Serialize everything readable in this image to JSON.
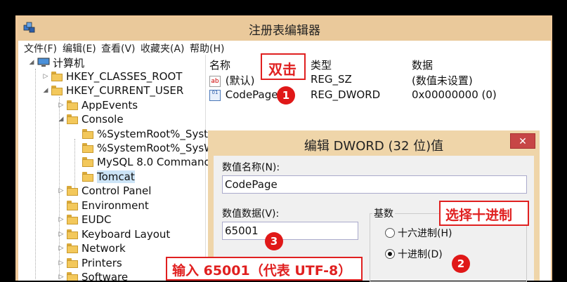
{
  "window": {
    "title": "注册表编辑器"
  },
  "menu": [
    "文件(F)",
    "编辑(E)",
    "查看(V)",
    "收藏夹(A)",
    "帮助(H)"
  ],
  "tree": [
    {
      "label": "计算机",
      "toggle": "◢"
    },
    {
      "label": "HKEY_CLASSES_ROOT",
      "toggle": "▷"
    },
    {
      "label": "HKEY_CURRENT_USER",
      "toggle": "◢"
    },
    {
      "label": "AppEvents",
      "toggle": "▷"
    },
    {
      "label": "Console",
      "toggle": "◢"
    },
    {
      "label": "%SystemRoot%_Syste",
      "toggle": ""
    },
    {
      "label": "%SystemRoot%_SysW",
      "toggle": ""
    },
    {
      "label": "MySQL 8.0 Command",
      "toggle": ""
    },
    {
      "label": "Tomcat",
      "toggle": ""
    },
    {
      "label": "Control Panel",
      "toggle": "▷"
    },
    {
      "label": "Environment",
      "toggle": ""
    },
    {
      "label": "EUDC",
      "toggle": "▷"
    },
    {
      "label": "Keyboard Layout",
      "toggle": "▷"
    },
    {
      "label": "Network",
      "toggle": "▷"
    },
    {
      "label": "Printers",
      "toggle": "▷"
    },
    {
      "label": "Software",
      "toggle": "▷"
    }
  ],
  "values_header": {
    "name": "名称",
    "type": "类型",
    "data": "数据"
  },
  "values": [
    {
      "icon": "ab",
      "name": "(默认)",
      "type": "REG_SZ",
      "data": "(数值未设置)"
    },
    {
      "icon": "01",
      "name": "CodePage",
      "type": "REG_DWORD",
      "data": "0x00000000 (0)"
    }
  ],
  "dialog": {
    "title": "编辑 DWORD (32 位)值",
    "close": "✕",
    "name_label": "数值名称(N):",
    "name_value": "CodePage",
    "data_label": "数值数据(V):",
    "data_value": "65001",
    "base_label": "基数",
    "hex_option": "十六进制(H)",
    "dec_option": "十进制(D)",
    "selected_base": "dec"
  },
  "annotations": {
    "double_click": "双击",
    "select_decimal": "选择十进制",
    "enter_value": "输入 65001（代表 UTF-8）",
    "steps": [
      "1",
      "2",
      "3"
    ]
  },
  "colors": {
    "accent_red": "#e02020",
    "title_bar": "#eac99b",
    "selection": "#cce4f7"
  }
}
